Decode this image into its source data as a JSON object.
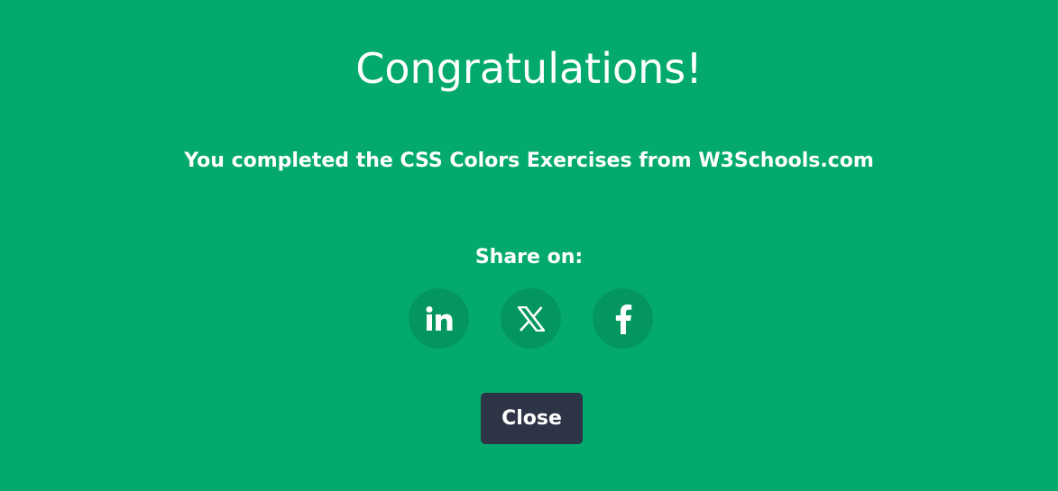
{
  "dialog": {
    "title": "Congratulations!",
    "message": "You completed the CSS Colors Exercises from W3Schools.com",
    "share_label": "Share on:",
    "share_buttons": [
      {
        "name": "linkedin",
        "icon": "linkedin-icon"
      },
      {
        "name": "x",
        "icon": "x-icon"
      },
      {
        "name": "facebook",
        "icon": "facebook-icon"
      }
    ],
    "close_label": "Close"
  },
  "colors": {
    "background": "#04AA6D",
    "share_button_bg": "#03975f",
    "close_button_bg": "#2d3446",
    "text": "#ffffff"
  }
}
